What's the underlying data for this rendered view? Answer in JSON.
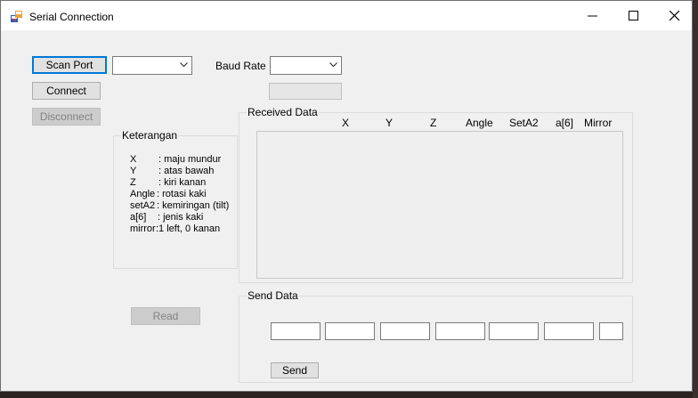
{
  "window": {
    "title": "Serial Connection",
    "controls": {
      "minimize": "minimize-icon",
      "maximize": "maximize-icon",
      "close": "close-icon"
    }
  },
  "connection": {
    "scan_port": "Scan Port",
    "connect": "Connect",
    "disconnect": "Disconnect",
    "port_value": "",
    "baud_label": "Baud Rate",
    "baud_value": ""
  },
  "keterangan": {
    "title": "Keterangan",
    "items": [
      {
        "key": "X",
        "desc": ": maju mundur"
      },
      {
        "key": "Y",
        "desc": ": atas bawah"
      },
      {
        "key": "Z",
        "desc": ": kiri kanan"
      },
      {
        "key": "Angle",
        "desc": ": rotasi kaki"
      },
      {
        "key": "setA2",
        "desc": ": kemiringan (tilt)"
      },
      {
        "key": "a[6]",
        "desc": ": jenis kaki"
      },
      {
        "key": "mirror",
        "desc": " :1 left, 0 kanan"
      }
    ]
  },
  "received": {
    "title": "Received Data",
    "columns": [
      "X",
      "Y",
      "Z",
      "Angle",
      "SetA2",
      "a[6]",
      "Mirror"
    ]
  },
  "read_button": "Read",
  "send": {
    "title": "Send Data",
    "fields": [
      "",
      "",
      "",
      "",
      "",
      "",
      ""
    ],
    "button": "Send"
  },
  "colors": {
    "focus_border": "#0078d7",
    "window_bg": "#f0f0f0",
    "titlebar_bg": "#ffffff"
  }
}
